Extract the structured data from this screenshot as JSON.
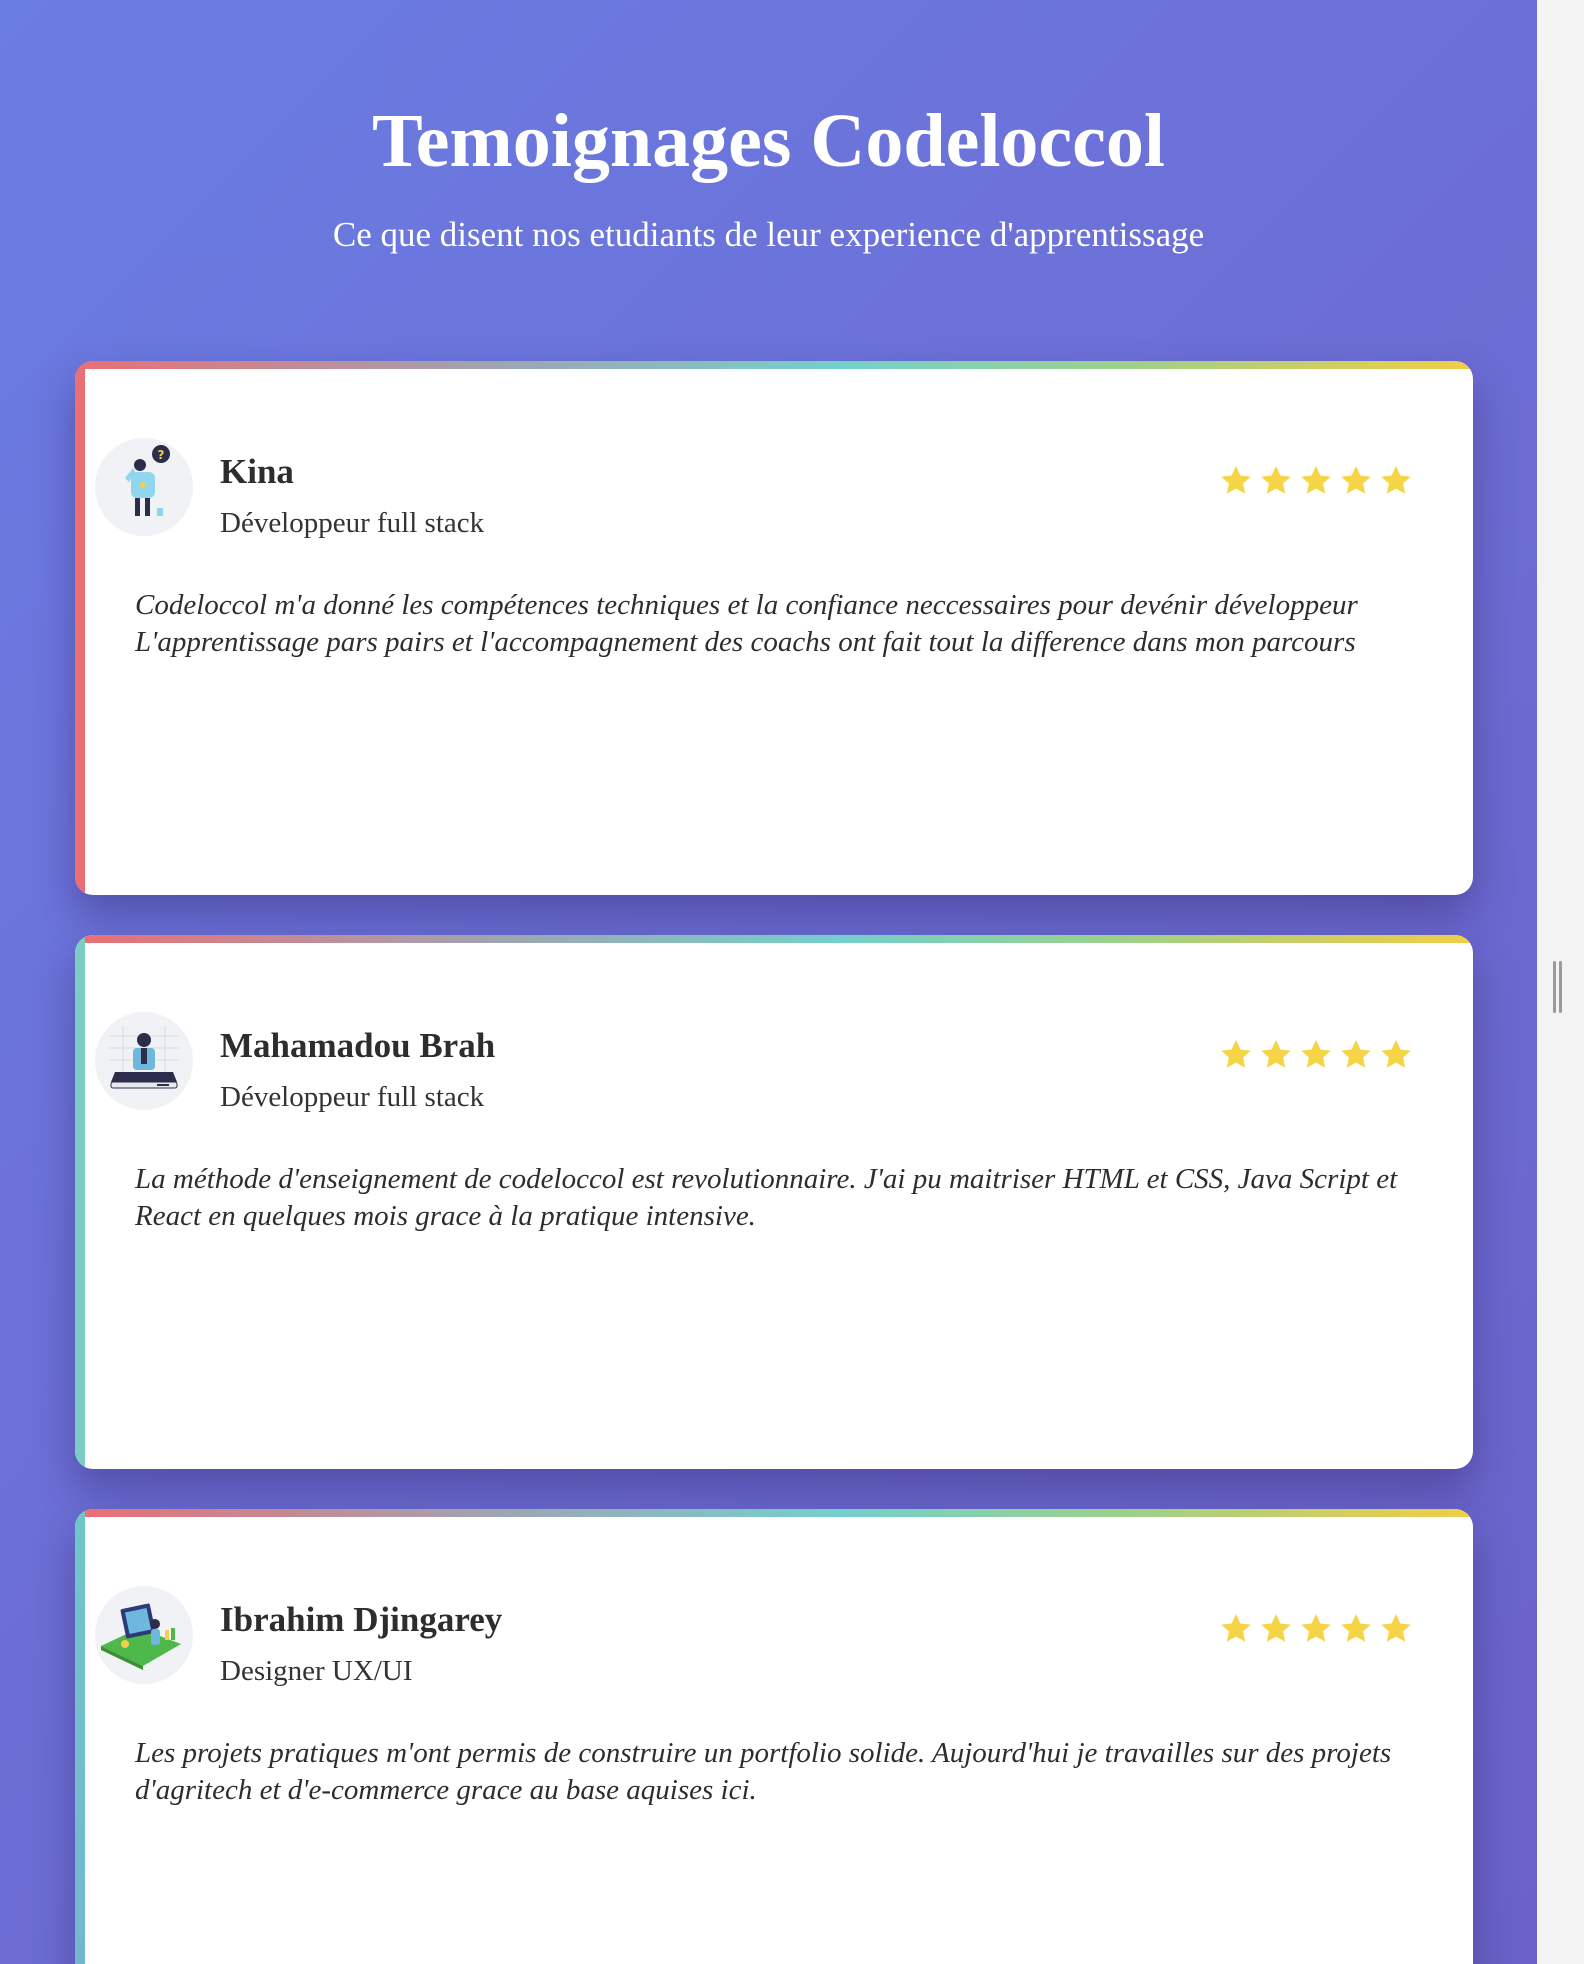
{
  "header": {
    "title": "Temoignages Codeloccol",
    "subtitle": "Ce que disent nos etudiants de leur experience d'apprentissage"
  },
  "testimonials": [
    {
      "name": "Kina",
      "role": "Développeur full stack",
      "rating": 5,
      "avatar_icon": "person-question-illustration-icon",
      "quote": "Codeloccol m'a donné les compétences techniques et la confiance neccessaires pour devénir développeur L'apprentissage pars pairs et l'accompagnement des coachs ont fait tout la difference dans mon parcours"
    },
    {
      "name": "Mahamadou Brah",
      "role": "Développeur full stack",
      "rating": 5,
      "avatar_icon": "developer-laptop-illustration-icon",
      "quote": "La méthode d'enseignement de codeloccol est revolutionnaire. J'ai pu maitriser HTML et CSS, Java Script et React en quelques mois grace à la pratique intensive."
    },
    {
      "name": "Ibrahim Djingarey",
      "role": "Designer UX/UI",
      "rating": 5,
      "avatar_icon": "designer-board-illustration-icon",
      "quote": "Les projets pratiques m'ont permis de construire un portfolio solide. Aujourd'hui je travailles sur des projets d'agritech et d'e-commerce grace au base aquises ici."
    }
  ],
  "colors": {
    "background_start": "#6a7de3",
    "background_end": "#6a62c8",
    "star": "#f5d547",
    "accent_red": "#ea6f74",
    "accent_teal": "#74d0ca",
    "accent_yellow": "#f2cd45"
  }
}
